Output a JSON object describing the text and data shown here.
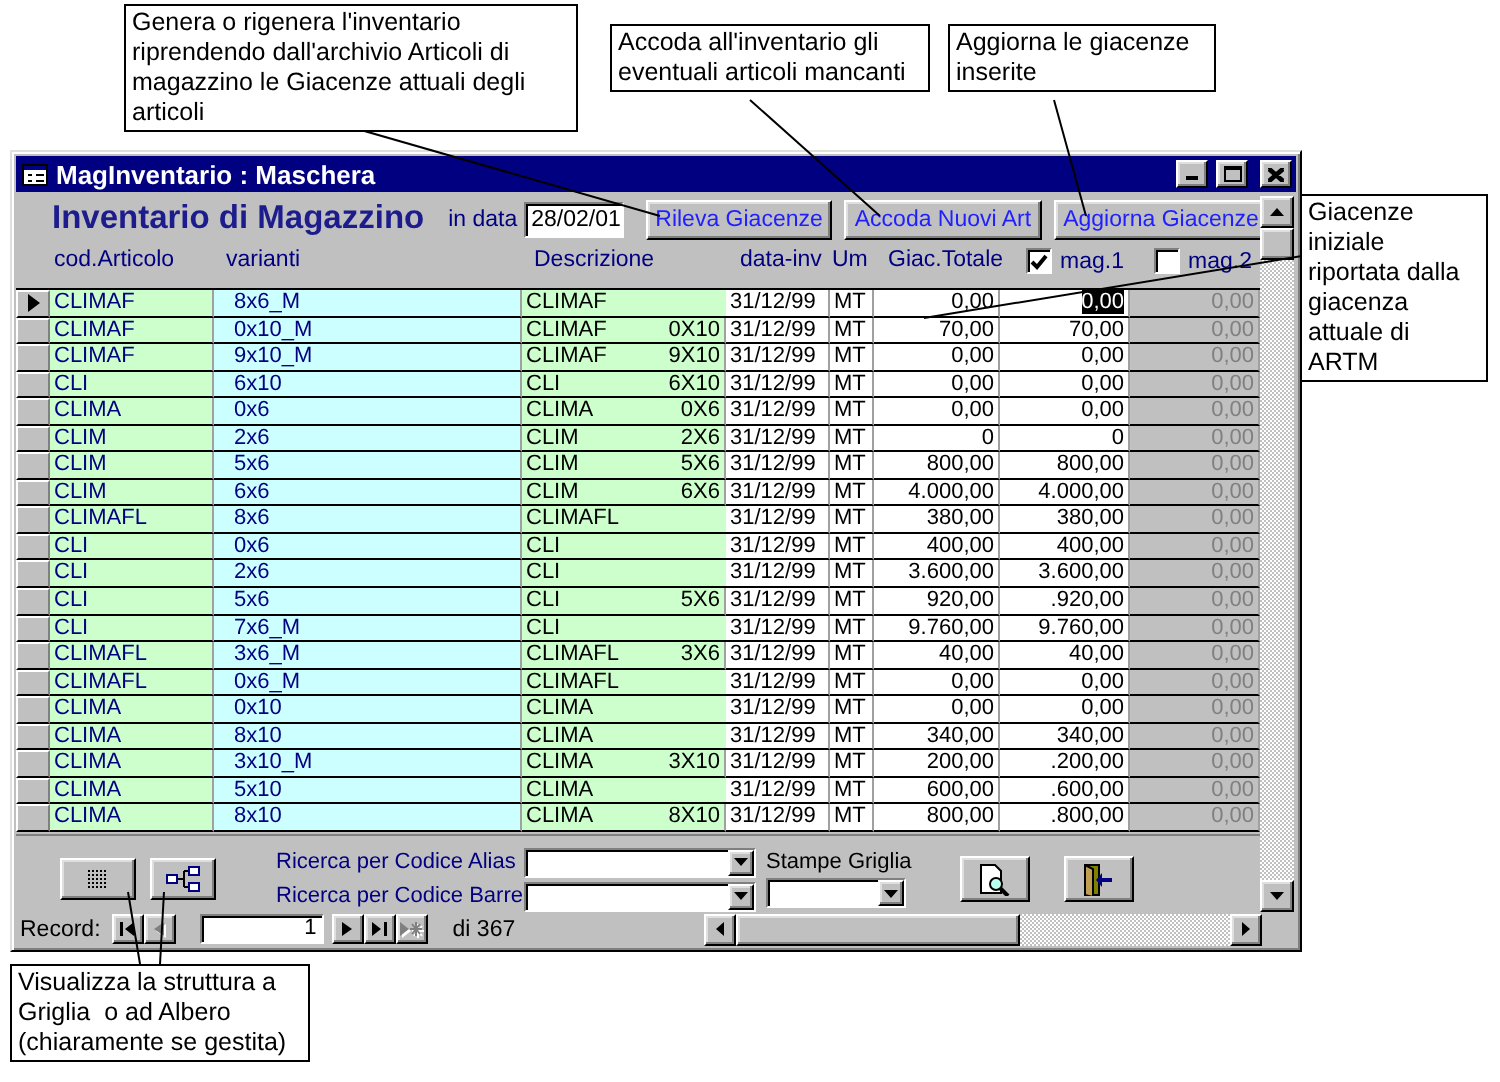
{
  "callouts": [
    {
      "text": "Genera o rigenera l'inventario riprendendo dall'archivio Articoli di magazzino le Giacenze attuali degli articoli"
    },
    {
      "text": "Accoda all'inventario gli eventuali articoli mancanti"
    },
    {
      "text": "Aggiorna le giacenze inserite"
    },
    {
      "text": "Giacenze iniziale riportata dalla giacenza attuale di ARTM"
    },
    {
      "text": "Visualizza la struttura a Griglia  o ad Albero (chiaramente se gestita)"
    }
  ],
  "window": {
    "title": "MagInventario : Maschera"
  },
  "header": {
    "title": "Inventario di Magazzino",
    "date_label": "in data",
    "date": "28/02/01",
    "buttons": [
      "Rileva Giacenze",
      "Accoda Nuovi Art",
      "Aggiorna Giacenze"
    ]
  },
  "table": {
    "columns": [
      {
        "label": "cod.Articolo",
        "kind": "text"
      },
      {
        "label": "varianti",
        "kind": "text"
      },
      {
        "label": "Descrizione",
        "kind": "text"
      },
      {
        "label": "data-inv",
        "kind": "text"
      },
      {
        "label": "Um",
        "kind": "text"
      },
      {
        "label": "Giac.Totale",
        "kind": "text"
      },
      {
        "label": "mag.1",
        "kind": "checkbox",
        "checked": true
      },
      {
        "label": "mag.2",
        "kind": "checkbox",
        "checked": false
      }
    ],
    "rows": [
      {
        "current": true,
        "cod_articolo": "CLIMAF",
        "varianti": "8x6_M",
        "descrizione": "CLIMAF",
        "data_inv": "31/12/99",
        "um": "MT",
        "giac_totale": "0,00",
        "mag_1": "0,00",
        "mag_2": "0,00"
      },
      {
        "current": false,
        "cod_articolo": "CLIMAF",
        "varianti": "0x10_M",
        "descrizione": "CLIMAF",
        "misura": "0X10",
        "data_inv": "31/12/99",
        "um": "MT",
        "giac_totale": "70,00",
        "mag_1": "70,00",
        "mag_2": "0,00"
      },
      {
        "current": false,
        "cod_articolo": "CLIMAF",
        "varianti": "9x10_M",
        "descrizione": "CLIMAF",
        "misura": "9X10",
        "data_inv": "31/12/99",
        "um": "MT",
        "giac_totale": "0,00",
        "mag_1": "0,00",
        "mag_2": "0,00"
      },
      {
        "current": false,
        "cod_articolo": "CLI",
        "varianti": "6x10",
        "descrizione": "CLI",
        "misura": "6X10",
        "data_inv": "31/12/99",
        "um": "MT",
        "giac_totale": "0,00",
        "mag_1": "0,00",
        "mag_2": "0,00"
      },
      {
        "current": false,
        "cod_articolo": "CLIMA",
        "varianti": "0x6",
        "descrizione": "CLIMA",
        "misura": "0X6",
        "data_inv": "31/12/99",
        "um": "MT",
        "giac_totale": "0,00",
        "mag_1": "0,00",
        "mag_2": "0,00"
      },
      {
        "current": false,
        "cod_articolo": "CLIM",
        "varianti": "2x6",
        "descrizione": "CLIM",
        "misura": "2X6",
        "data_inv": "31/12/99",
        "um": "MT",
        "giac_totale": "0",
        "mag_1": "0",
        "mag_2": "0,00"
      },
      {
        "current": false,
        "cod_articolo": "CLIM",
        "varianti": "5x6",
        "descrizione": "CLIM",
        "misura": "5X6",
        "data_inv": "31/12/99",
        "um": "MT",
        "giac_totale": "800,00",
        "mag_1": "800,00",
        "mag_2": "0,00"
      },
      {
        "current": false,
        "cod_articolo": "CLIM",
        "varianti": "6x6",
        "descrizione": "CLIM",
        "misura": "6X6",
        "data_inv": "31/12/99",
        "um": "MT",
        "giac_totale": "4.000,00",
        "mag_1": "4.000,00",
        "mag_2": "0,00"
      },
      {
        "current": false,
        "cod_articolo": "CLIMAFL",
        "varianti": "8x6",
        "descrizione": "CLIMAFL",
        "data_inv": "31/12/99",
        "um": "MT",
        "giac_totale": "380,00",
        "mag_1": "380,00",
        "mag_2": "0,00"
      },
      {
        "current": false,
        "cod_articolo": "CLI",
        "varianti": "0x6",
        "descrizione": "CLI",
        "data_inv": "31/12/99",
        "um": "MT",
        "giac_totale": "400,00",
        "mag_1": "400,00",
        "mag_2": "0,00"
      },
      {
        "current": false,
        "cod_articolo": "CLI",
        "varianti": "2x6",
        "descrizione": "CLI",
        "data_inv": "31/12/99",
        "um": "MT",
        "giac_totale": "3.600,00",
        "mag_1": "3.600,00",
        "mag_2": "0,00"
      },
      {
        "current": false,
        "cod_articolo": "CLI",
        "varianti": "5x6",
        "descrizione": "CLI",
        "misura": "5X6",
        "data_inv": "31/12/99",
        "um": "MT",
        "giac_totale": "920,00",
        "mag_1": ".920,00",
        "mag_2": "0,00"
      },
      {
        "current": false,
        "cod_articolo": "CLI",
        "varianti": "7x6_M",
        "descrizione": "CLI",
        "data_inv": "31/12/99",
        "um": "MT",
        "giac_totale": "9.760,00",
        "mag_1": "9.760,00",
        "mag_2": "0,00"
      },
      {
        "current": false,
        "cod_articolo": "CLIMAFL",
        "varianti": "3x6_M",
        "descrizione": "CLIMAFL",
        "misura": "3X6",
        "data_inv": "31/12/99",
        "um": "MT",
        "giac_totale": "40,00",
        "mag_1": "40,00",
        "mag_2": "0,00"
      },
      {
        "current": false,
        "cod_articolo": "CLIMAFL",
        "varianti": "0x6_M",
        "descrizione": "CLIMAFL",
        "data_inv": "31/12/99",
        "um": "MT",
        "giac_totale": "0,00",
        "mag_1": "0,00",
        "mag_2": "0,00"
      },
      {
        "current": false,
        "cod_articolo": "CLIMA",
        "varianti": "0x10",
        "descrizione": "CLIMA",
        "data_inv": "31/12/99",
        "um": "MT",
        "giac_totale": "0,00",
        "mag_1": "0,00",
        "mag_2": "0,00"
      },
      {
        "current": false,
        "cod_articolo": "CLIMA",
        "varianti": "8x10",
        "descrizione": "CLIMA",
        "data_inv": "31/12/99",
        "um": "MT",
        "giac_totale": "340,00",
        "mag_1": "340,00",
        "mag_2": "0,00"
      },
      {
        "current": false,
        "cod_articolo": "CLIMA",
        "varianti": "3x10_M",
        "descrizione": "CLIMA",
        "misura": "3X10",
        "data_inv": "31/12/99",
        "um": "MT",
        "giac_totale": "200,00",
        "mag_1": ".200,00",
        "mag_2": "0,00"
      },
      {
        "current": false,
        "cod_articolo": "CLIMA",
        "varianti": "5x10",
        "descrizione": "CLIMA",
        "data_inv": "31/12/99",
        "um": "MT",
        "giac_totale": "600,00",
        "mag_1": ".600,00",
        "mag_2": "0,00"
      },
      {
        "current": false,
        "cod_articolo": "CLIMA",
        "varianti": "8x10",
        "descrizione": "CLIMA",
        "misura": "8X10",
        "data_inv": "31/12/99",
        "um": "MT",
        "giac_totale": "800,00",
        "mag_1": ".800,00",
        "mag_2": "0,00"
      }
    ]
  },
  "footer": {
    "search": [
      {
        "label": "Ricerca per Codice Alias"
      },
      {
        "label": "Ricerca per Codice Barre"
      }
    ],
    "print": {
      "label": "Stampe Griglia"
    }
  },
  "navigation": {
    "label": "Record:",
    "current": "1",
    "total": "di 367",
    "buttons": [
      {
        "kind": "first",
        "disabled": false
      },
      {
        "kind": "prev",
        "disabled": true
      },
      {
        "kind": "next",
        "disabled": false
      },
      {
        "kind": "last",
        "disabled": false
      },
      {
        "kind": "new",
        "disabled": true
      }
    ]
  }
}
